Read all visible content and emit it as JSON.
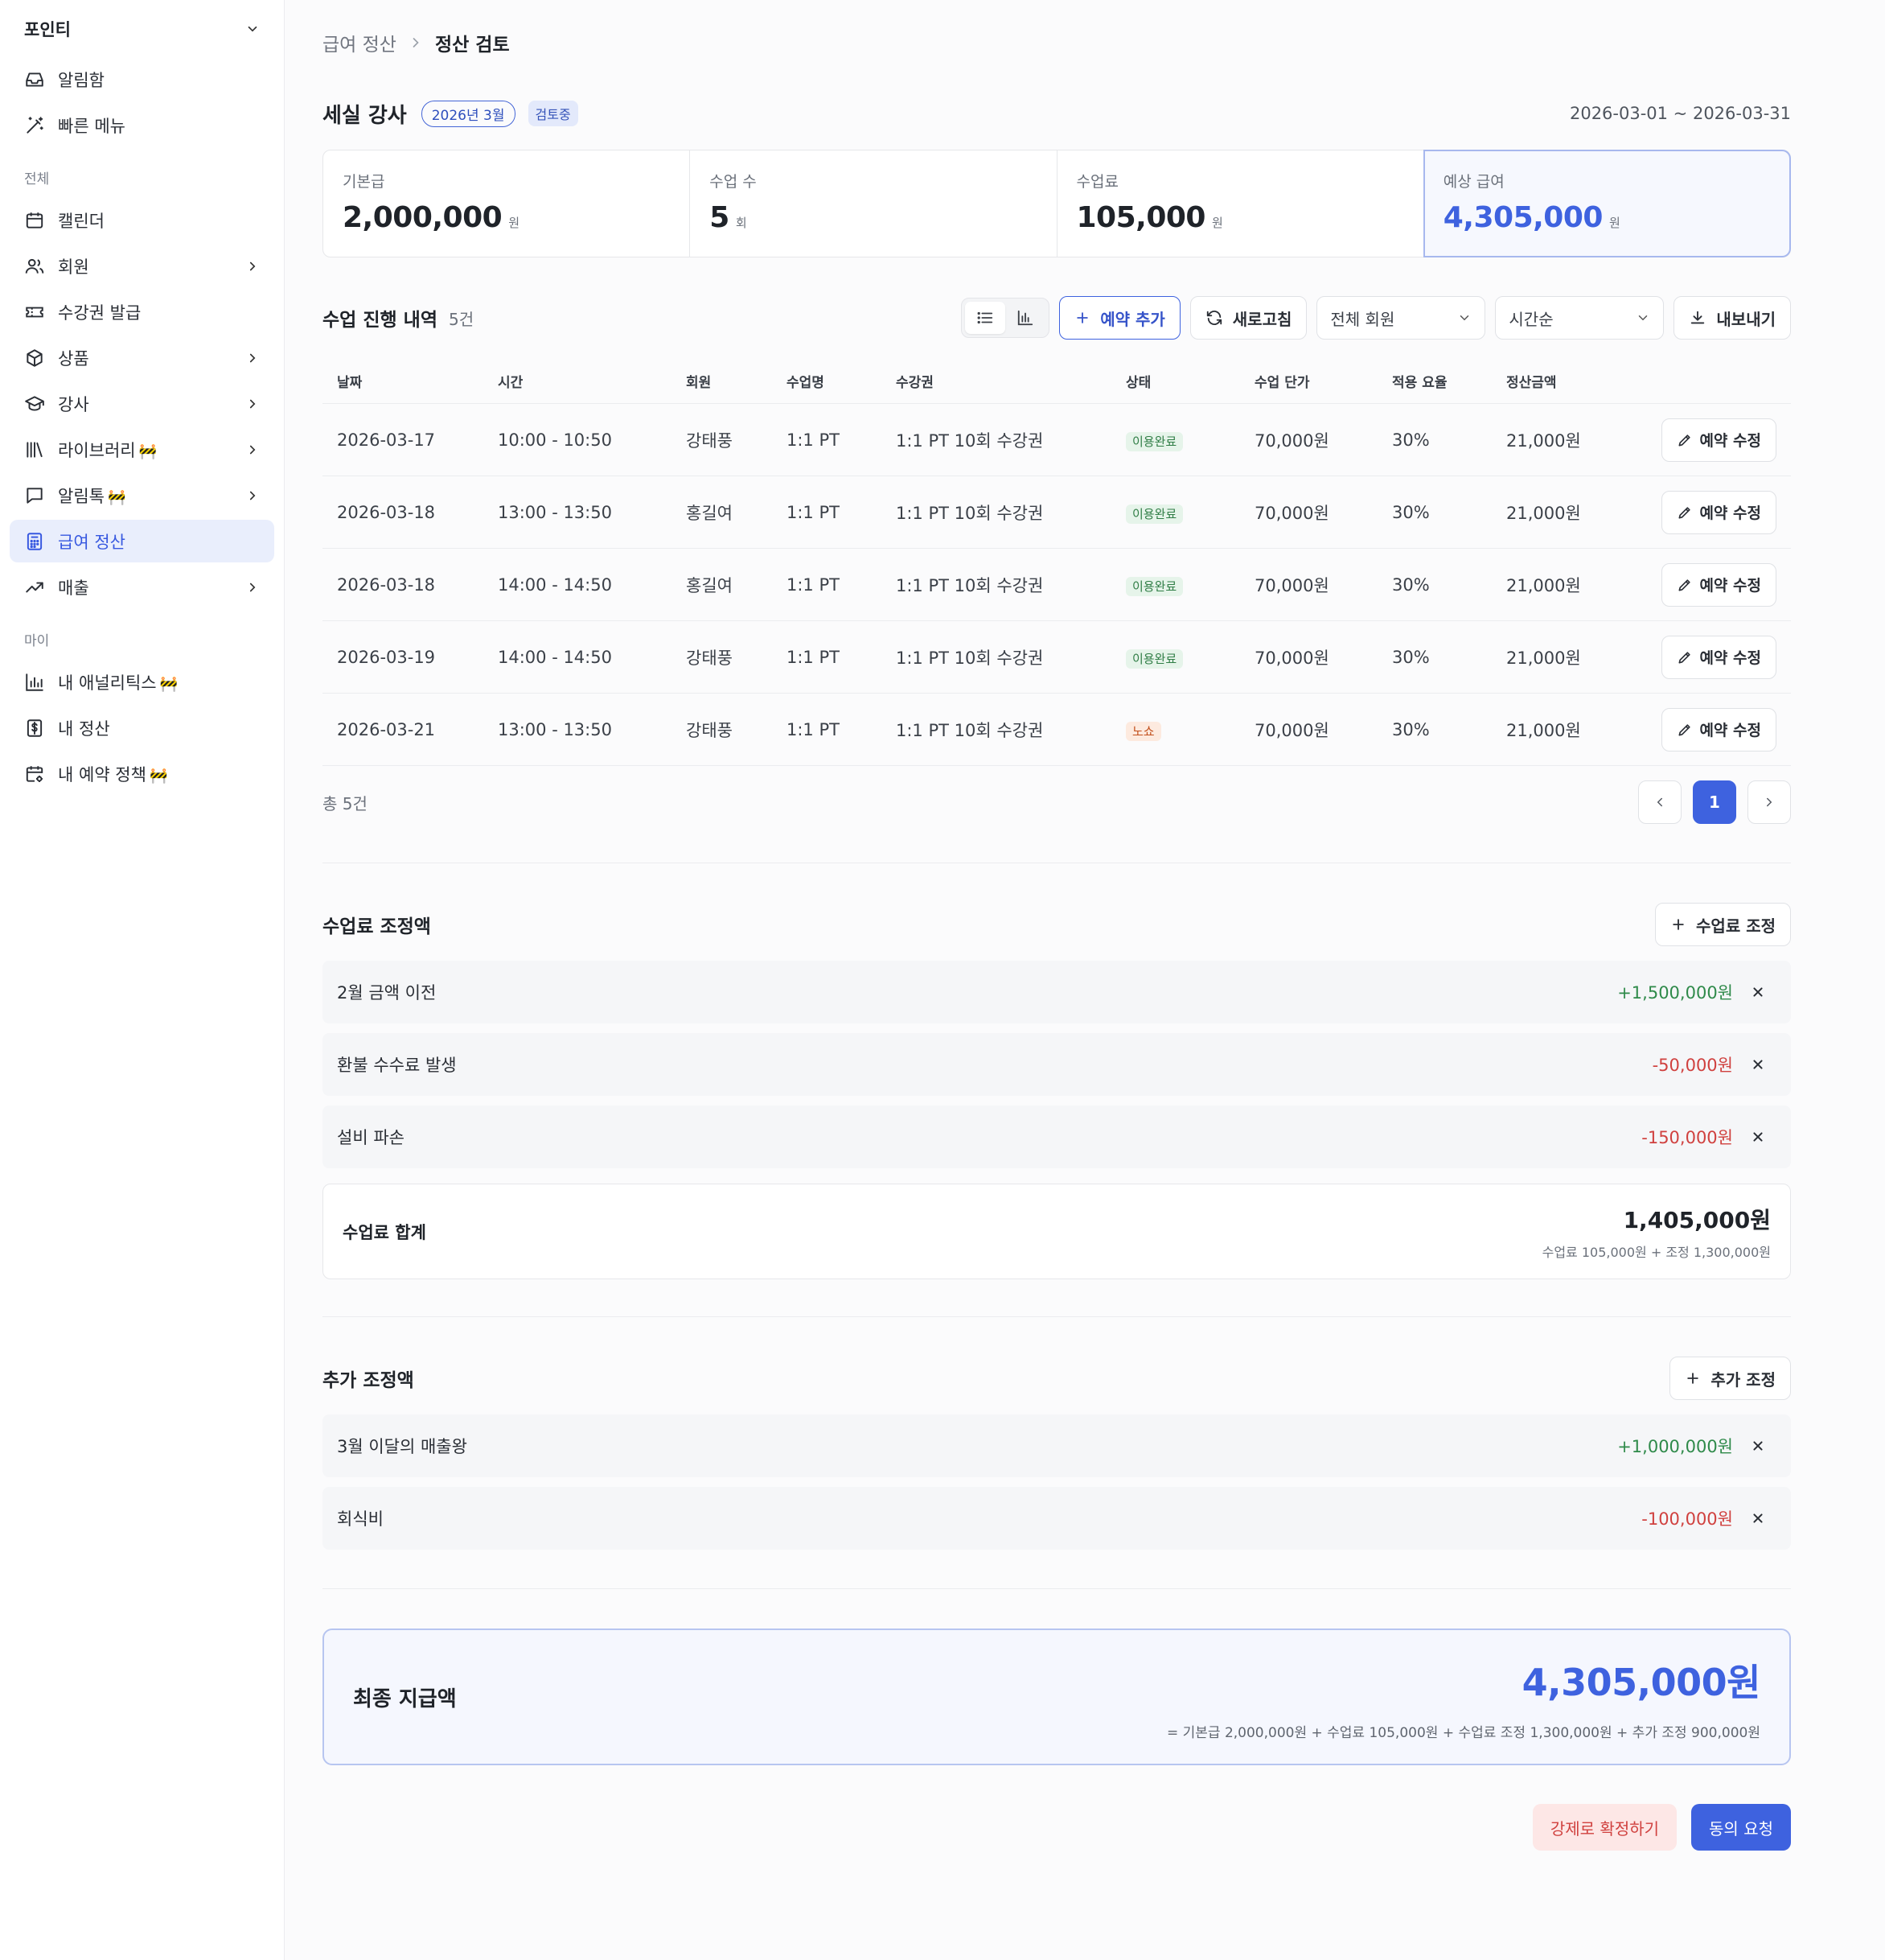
{
  "sidebar": {
    "workspace": "포인티",
    "top_items": [
      {
        "label": "알림함"
      },
      {
        "label": "빠른 메뉴"
      }
    ],
    "section_all": "전체",
    "items": [
      {
        "label": "캘린더"
      },
      {
        "label": "회원"
      },
      {
        "label": "수강권 발급"
      },
      {
        "label": "상품"
      },
      {
        "label": "강사"
      },
      {
        "label": "라이브러리",
        "badge": "🚧"
      },
      {
        "label": "알림톡",
        "badge": "🚧"
      },
      {
        "label": "급여 정산"
      },
      {
        "label": "매출"
      }
    ],
    "section_my": "마이",
    "my_items": [
      {
        "label": "내 애널리틱스",
        "badge": "🚧"
      },
      {
        "label": "내 정산"
      },
      {
        "label": "내 예약 정책",
        "badge": "🚧"
      }
    ]
  },
  "breadcrumb": {
    "parent": "급여 정산",
    "current": "정산 검토"
  },
  "header": {
    "title": "세실 강사",
    "month_badge": "2026년 3월",
    "status_badge": "검토중",
    "period": "2026-03-01 ~ 2026-03-31"
  },
  "stats": [
    {
      "label": "기본급",
      "value": "2,000,000",
      "unit": "원"
    },
    {
      "label": "수업 수",
      "value": "5",
      "unit": "회"
    },
    {
      "label": "수업료",
      "value": "105,000",
      "unit": "원"
    },
    {
      "label": "예상 급여",
      "value": "4,305,000",
      "unit": "원"
    }
  ],
  "lessons": {
    "title": "수업 진행 내역",
    "count": "5건",
    "add_button": "예약 추가",
    "refresh_button": "새로고침",
    "member_filter": "전체 회원",
    "sort_filter": "시간순",
    "export_button": "내보내기",
    "columns": [
      "날짜",
      "시간",
      "회원",
      "수업명",
      "수강권",
      "상태",
      "수업 단가",
      "적용 요율",
      "정산금액"
    ],
    "rows": [
      {
        "date": "2026-03-17",
        "time": "10:00 - 10:50",
        "member": "강태풍",
        "class": "1:1 PT",
        "pass": "1:1 PT 10회 수강권",
        "status": "이용완료",
        "price": "70,000원",
        "rate": "30%",
        "amount": "21,000원",
        "action": "예약 수정"
      },
      {
        "date": "2026-03-18",
        "time": "13:00 - 13:50",
        "member": "홍길여",
        "class": "1:1 PT",
        "pass": "1:1 PT 10회 수강권",
        "status": "이용완료",
        "price": "70,000원",
        "rate": "30%",
        "amount": "21,000원",
        "action": "예약 수정"
      },
      {
        "date": "2026-03-18",
        "time": "14:00 - 14:50",
        "member": "홍길여",
        "class": "1:1 PT",
        "pass": "1:1 PT 10회 수강권",
        "status": "이용완료",
        "price": "70,000원",
        "rate": "30%",
        "amount": "21,000원",
        "action": "예약 수정"
      },
      {
        "date": "2026-03-19",
        "time": "14:00 - 14:50",
        "member": "강태풍",
        "class": "1:1 PT",
        "pass": "1:1 PT 10회 수강권",
        "status": "이용완료",
        "price": "70,000원",
        "rate": "30%",
        "amount": "21,000원",
        "action": "예약 수정"
      },
      {
        "date": "2026-03-21",
        "time": "13:00 - 13:50",
        "member": "강태풍",
        "class": "1:1 PT",
        "pass": "1:1 PT 10회 수강권",
        "status": "노쇼",
        "price": "70,000원",
        "rate": "30%",
        "amount": "21,000원",
        "action": "예약 수정"
      }
    ],
    "total": "총 5건",
    "page": "1"
  },
  "fee_adjust": {
    "title": "수업료 조정액",
    "button": "수업료 조정",
    "items": [
      {
        "label": "2월 금액 이전",
        "value": "+1,500,000원"
      },
      {
        "label": "환불 수수료 발생",
        "value": "-50,000원"
      },
      {
        "label": "설비 파손",
        "value": "-150,000원"
      }
    ],
    "sum_label": "수업료 합계",
    "sum_value": "1,405,000원",
    "sum_detail": "수업료 105,000원 + 조정 1,300,000원"
  },
  "extra_adjust": {
    "title": "추가 조정액",
    "button": "추가 조정",
    "items": [
      {
        "label": "3월 이달의 매출왕",
        "value": "+1,000,000원"
      },
      {
        "label": "회식비",
        "value": "-100,000원"
      }
    ]
  },
  "final": {
    "label": "최종 지급액",
    "value": "4,305,000원",
    "formula": "= 기본급 2,000,000원 + 수업료 105,000원 + 수업료 조정 1,300,000원 + 추가 조정 900,000원"
  },
  "actions": {
    "force": "강제로 확정하기",
    "agree": "동의 요청"
  },
  "colors": {
    "accent": "#3e62df",
    "positive": "#2f8a4a",
    "negative": "#d0413f"
  }
}
